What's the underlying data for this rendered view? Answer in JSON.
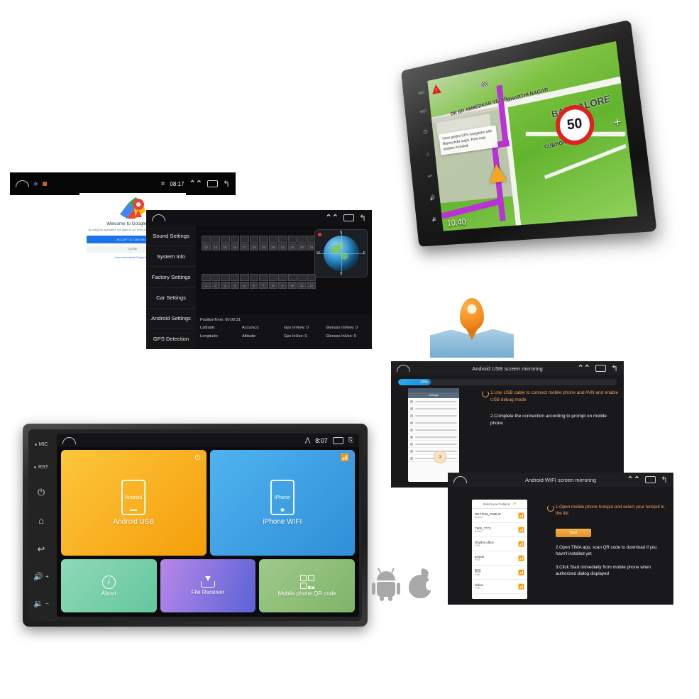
{
  "thin_status_bar": {
    "home_icon": "cloud-home-icon",
    "bluetooth_icon": "bluetooth-icon",
    "time": "08:17",
    "chevron_icon": "chevron-up-icon",
    "apps_icon": "apps-icon",
    "back_icon": "back-icon"
  },
  "google_maps": {
    "logo_icon": "google-maps-pin-icon",
    "title": "Welcome to Google Maps",
    "terms_text": "By using this application, you agree to our Terms of Service and Privacy Policy",
    "accept_label": "ACCEPT & CONTINUE",
    "close_label": "CLOSE",
    "learn_more": "Learn more about Google Maps",
    "accent": "#1a73e8"
  },
  "gps_panel": {
    "status": {
      "home_icon": "cloud-home-icon",
      "chevron_icon": "chevron-up-icon",
      "apps_icon": "apps-icon",
      "back_icon": "back-icon"
    },
    "menu": [
      "Sound Settings",
      "System Info",
      "Factory Settings",
      "Car Settings",
      "Android Settings",
      "GPS Detection"
    ],
    "sat_group_top": [
      "13",
      "14",
      "15",
      "16",
      "17",
      "18",
      "19",
      "20",
      "21",
      "22",
      "23",
      "24"
    ],
    "sat_group_bottom": [
      "1",
      "2",
      "3",
      "4",
      "5",
      "6",
      "7",
      "8",
      "9",
      "10",
      "11",
      "12"
    ],
    "compass": {
      "n": "N",
      "s": "S",
      "e": "E",
      "w": "W"
    },
    "refresh_icon": "refresh-icon",
    "readout": {
      "position_time_label": "PositionTime: 00:00:31",
      "latitude_label": "Latitude:",
      "longitude_label": "Longitude:",
      "accuracy_label": "Accuracy:",
      "altitude_label": "Altitude:",
      "gps_inview": "Gps InView: 0",
      "gps_inuse": "Gps InUse: 0",
      "glonass_inview": "Glonass InView: 0",
      "glonass_inuse": "Glonass InUse: 0"
    }
  },
  "nav_unit": {
    "side_buttons": [
      "MIC",
      "RST",
      "power-icon",
      "home-icon",
      "back-icon",
      "vol-up-icon",
      "vol-down-icon"
    ],
    "map": {
      "callout": "Voice guided GPS navigation with Mapmyindia maps. Free map updates included.",
      "labels": [
        "DR BR AMBEDKAR VEDHI",
        "BHARTHI NAGAR",
        "BANGALORE",
        "CUBBON PARK"
      ],
      "speed_limit": "50",
      "clock": "10:40",
      "zoom_in": "+",
      "warning_icon": "warning-triangle-icon",
      "destination_icon": "checkered-flag-icon",
      "route_color": "#b832d4"
    }
  },
  "pin_graphic": {
    "icon": "map-pin-world-icon"
  },
  "usb_panel": {
    "title": "Android USB screen mirroring",
    "status": {
      "home_icon": "cloud-home-icon",
      "chevron_icon": "chevron-up-icon",
      "apps_icon": "apps-icon",
      "back_icon": "back-icon"
    },
    "progress_percent": "15%",
    "progress_value": 15,
    "progress_color": "#1d8ed6",
    "phone_mock": {
      "header": "Settings",
      "badge": "3",
      "rows": [
        "Sound & vibration",
        "Lock screen & password",
        "Notifications & status bar",
        "Home screen & Recents",
        "Sound mode",
        "Battery",
        "Storage",
        "All Apps",
        "Additional settings"
      ]
    },
    "steps": [
      "1.Use USB cable to connect mobile phone and AVN and enable USB debug mode",
      "2.Complete the connection according to prompt on mobile phone"
    ]
  },
  "wifi_panel": {
    "title": "Android WIFI screen mirroring",
    "status": {
      "home_icon": "cloud-home-icon",
      "chevron_icon": "chevron-up-icon",
      "apps_icon": "apps-icon",
      "back_icon": "back-icon"
    },
    "hotspot_header": "Select your hotspot",
    "hotspot_refresh_icon": "refresh-icon",
    "hotspots": [
      {
        "ssid": "RHYTHM_PUBLIC",
        "status": "Saved"
      },
      {
        "ssid": "T900_7773",
        "status": "Saved"
      },
      {
        "ssid": "Rhythm office",
        "status": "PSK"
      },
      {
        "ssid": "amp02",
        "status": "PSK"
      },
      {
        "ssid": "影音",
        "status": "PSK"
      },
      {
        "ssid": "rtidion",
        "status": "PSK"
      }
    ],
    "start_button": "Start",
    "steps": [
      "1.Open mobile phone hotspot and select your hotspot in the list",
      "2.Open TIMA app, scan QR code to download if you havn't installed yet",
      "3.Click Start immediatly from mobile phone when authorized dialog displayed"
    ]
  },
  "stereo": {
    "side_buttons": [
      {
        "label": "MIC",
        "icon": "mic-dot-icon"
      },
      {
        "label": "RST",
        "icon": "reset-dot-icon"
      },
      {
        "label": "",
        "icon": "power-icon",
        "glyph": "⏻"
      },
      {
        "label": "",
        "icon": "home-icon",
        "glyph": "⌂"
      },
      {
        "label": "",
        "icon": "back-icon",
        "glyph": "↩"
      },
      {
        "label": "+",
        "icon": "volume-up-icon",
        "glyph": "🔊"
      },
      {
        "label": "−",
        "icon": "volume-down-icon",
        "glyph": "🔈"
      }
    ],
    "status": {
      "home_icon": "cloud-home-icon",
      "signal_icon": "signal-icon",
      "time": "8:07",
      "battery_icon": "battery-icon",
      "eject_icon": "eject-icon"
    },
    "tiles": [
      {
        "label": "Android USB",
        "icon": "android-phone-icon",
        "badge": "usb-icon",
        "phone_text": "Android",
        "color": "#f59e0b"
      },
      {
        "label": "iPhone WIFI",
        "icon": "iphone-icon",
        "badge": "wifi-icon",
        "phone_text": "iPhone",
        "color": "#2f8fd8"
      },
      {
        "label": "About",
        "icon": "info-icon",
        "color": "#63c79c"
      },
      {
        "label": "File Receiver",
        "icon": "inbox-download-icon",
        "color": "#5b63d6"
      },
      {
        "label": "Mobile phone QR code",
        "icon": "qr-code-icon",
        "color": "#7fb567"
      }
    ]
  },
  "os_logos": {
    "android": "android-robot-icon",
    "apple": "apple-logo-icon"
  }
}
